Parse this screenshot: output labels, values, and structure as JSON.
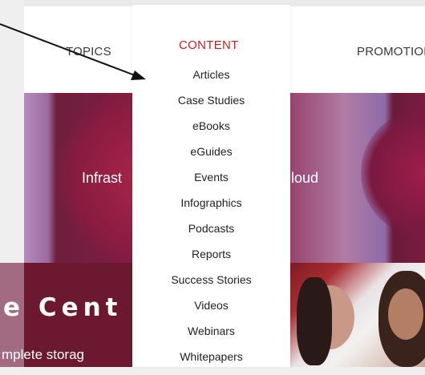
{
  "nav": {
    "topics": "TOPICS",
    "content": "CONTENT",
    "promotions": "PROMOTIONS",
    "content_color": "#cc1f1f"
  },
  "dropdown": {
    "items": [
      "Articles",
      "Case Studies",
      "eBooks",
      "eGuides",
      "Events",
      "Infographics",
      "Podcasts",
      "Reports",
      "Success Stories",
      "Videos",
      "Webinars",
      "Whitepapers"
    ]
  },
  "hero": {
    "left_text": "Infrast",
    "right_text": "loud"
  },
  "lower": {
    "title": "e Cent",
    "subtitle": "mplete storag"
  }
}
